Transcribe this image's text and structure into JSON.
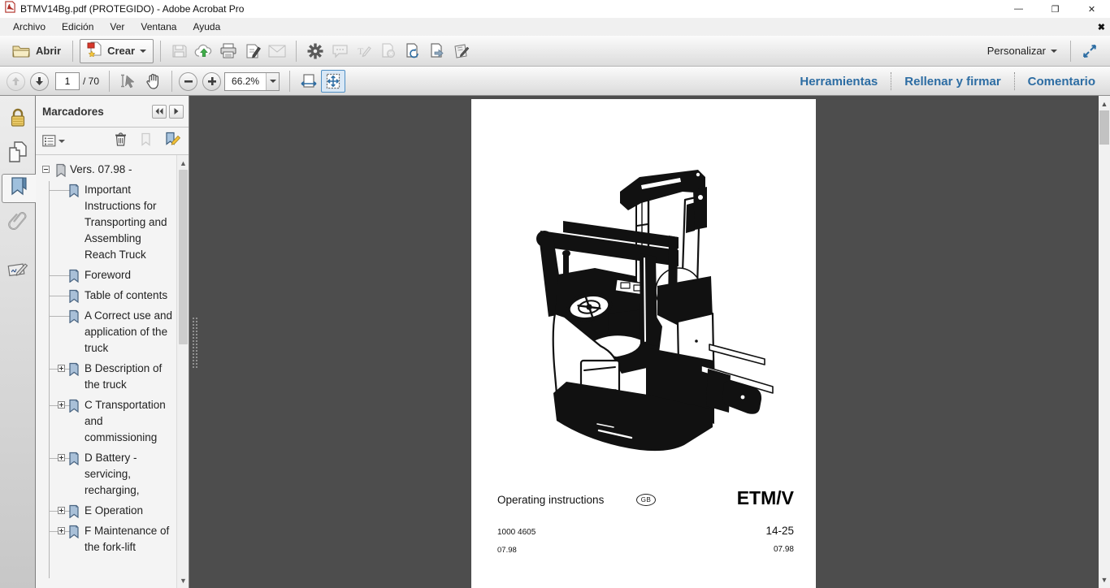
{
  "window": {
    "title": "BTMV14Bg.pdf (PROTEGIDO) - Adobe Acrobat Pro",
    "minimize_glyph": "—",
    "restore_glyph": "❐",
    "close_glyph": "✕",
    "close_document_glyph": "✖"
  },
  "menubar": {
    "items": [
      "Archivo",
      "Edición",
      "Ver",
      "Ventana",
      "Ayuda"
    ]
  },
  "toolbar": {
    "open_label": "Abrir",
    "create_label": "Crear",
    "personalize_label": "Personalizar"
  },
  "navbar": {
    "page_value": "1",
    "page_total": "/ 70",
    "zoom_value": "66.2%",
    "tools_label": "Herramientas",
    "fill_sign_label": "Rellenar y firmar",
    "comment_label": "Comentario"
  },
  "bookmarks": {
    "title": "Marcadores",
    "items": [
      {
        "label": "Vers. 07.98 -",
        "level": 0,
        "expander": "minus",
        "icon": "gray"
      },
      {
        "label": "Important Instructions for Transporting and Assembling Reach Truck",
        "level": 1,
        "expander": "none",
        "icon": "blue"
      },
      {
        "label": "Foreword",
        "level": 1,
        "expander": "none",
        "icon": "blue"
      },
      {
        "label": "Table of contents",
        "level": 1,
        "expander": "none",
        "icon": "blue"
      },
      {
        "label": "A Correct use and application of the truck",
        "level": 1,
        "expander": "none",
        "icon": "blue"
      },
      {
        "label": "B Description of the truck",
        "level": 1,
        "expander": "plus",
        "icon": "blue"
      },
      {
        "label": "C Transportation and commissioning",
        "level": 1,
        "expander": "plus",
        "icon": "blue"
      },
      {
        "label": "D Battery - servicing, recharging,",
        "level": 1,
        "expander": "plus",
        "icon": "blue"
      },
      {
        "label": "E Operation",
        "level": 1,
        "expander": "plus",
        "icon": "blue"
      },
      {
        "label": "F Maintenance of the fork-lift",
        "level": 1,
        "expander": "plus",
        "icon": "blue"
      }
    ]
  },
  "document_page": {
    "operating_instructions": "Operating instructions",
    "language_badge": "GB",
    "model": "ETM/V",
    "doc_number": "1000 4605",
    "section_page": "14-25",
    "date_left": "07.98",
    "date_right": "07.98"
  },
  "colors": {
    "accent_blue": "#2d6da3",
    "canvas_dark": "#4d4d4d",
    "lock_yellow": "#e9c967",
    "create_flag_red": "#d9372b",
    "upload_green": "#3fae49"
  }
}
